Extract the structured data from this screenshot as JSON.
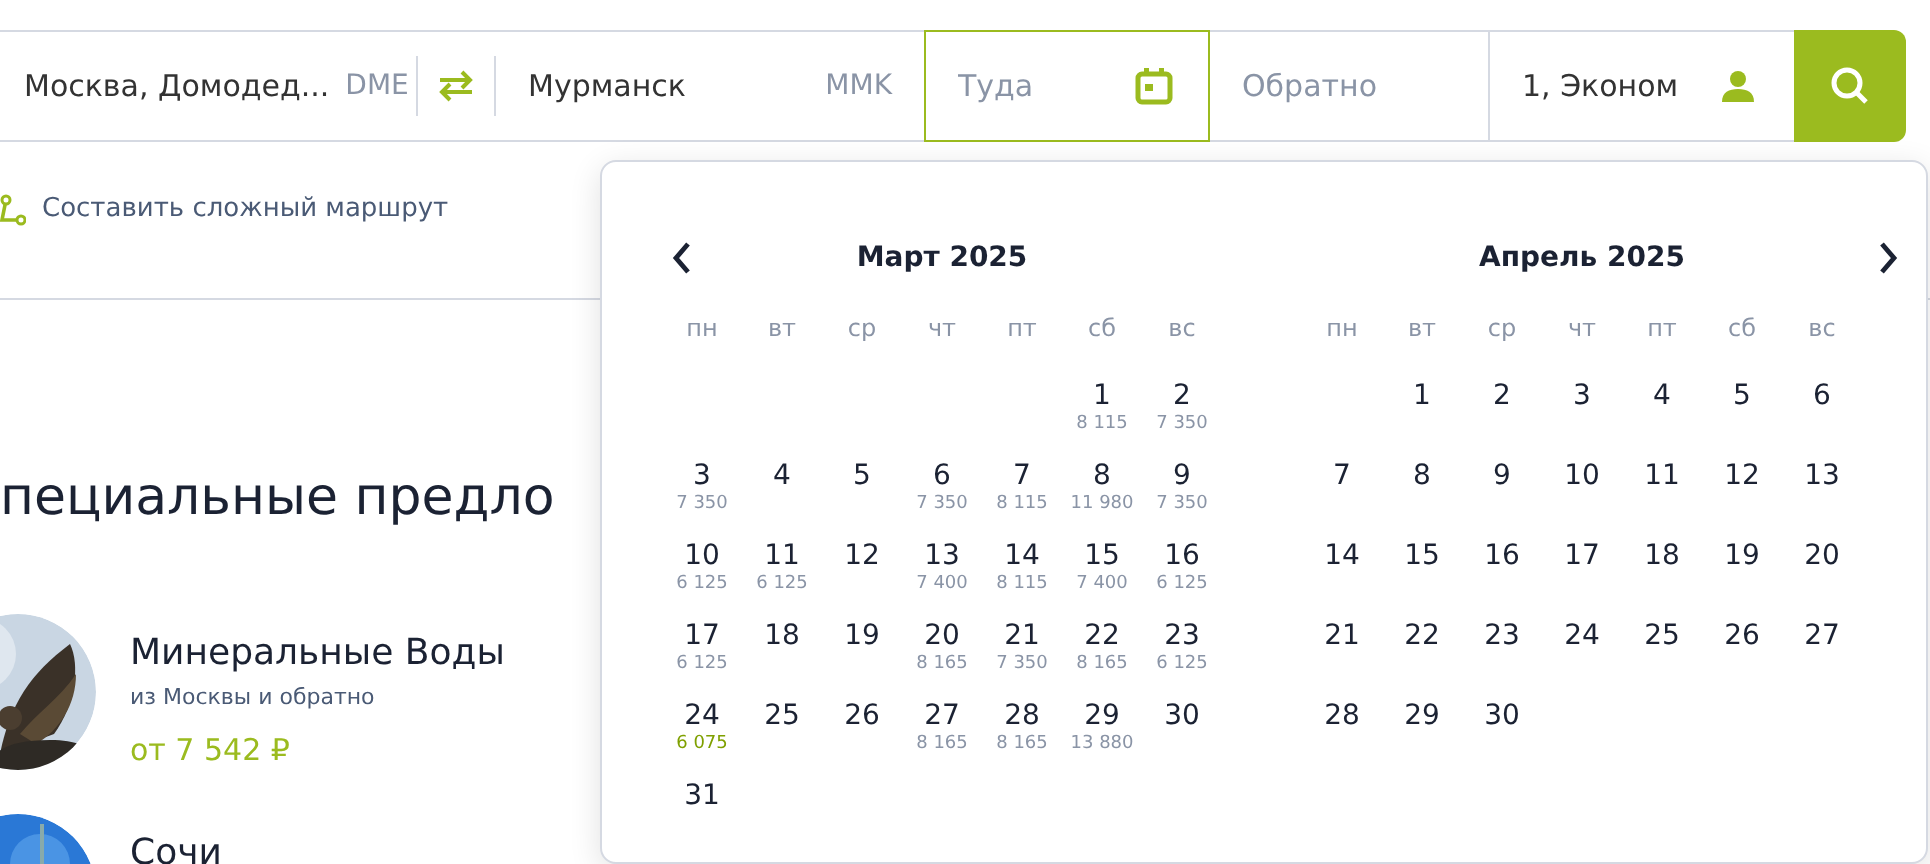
{
  "search_bar": {
    "origin": {
      "value": "Москва, Домодед...",
      "code": "DME"
    },
    "destination": {
      "value": "Мурманск",
      "code": "MMK"
    },
    "depart": {
      "placeholder": "Туда",
      "focused": true
    },
    "return": {
      "placeholder": "Обратно",
      "focused": false
    },
    "passengers": {
      "value": "1, Эконом"
    }
  },
  "complex_route_link": "Составить сложный маршрут",
  "heading": "пециальные предло",
  "offers": [
    {
      "title": "Минеральные Воды",
      "subtitle": "из Москвы и обратно",
      "price": "от 7 542 ₽",
      "kind": "statue"
    },
    {
      "title": "Сочи",
      "kind": "sky"
    }
  ],
  "calendar": {
    "months": [
      {
        "title": "Март 2025",
        "weekdays": [
          "пн",
          "вт",
          "ср",
          "чт",
          "пт",
          "сб",
          "вс"
        ],
        "weeks": [
          [
            {
              "day": "1",
              "price": "8 115",
              "cheapest": false
            },
            {
              "day": "2",
              "price": "7 350",
              "cheapest": false
            }
          ],
          [
            {
              "day": "3",
              "price": "7 350",
              "cheapest": false
            },
            {
              "day": "4"
            },
            {
              "day": "5"
            },
            {
              "day": "6",
              "price": "7 350",
              "cheapest": false
            },
            {
              "day": "7",
              "price": "8 115",
              "cheapest": false
            },
            {
              "day": "8",
              "price": "11 980",
              "cheapest": false
            },
            {
              "day": "9",
              "price": "7 350",
              "cheapest": false
            }
          ],
          [
            {
              "day": "10",
              "price": "6 125",
              "cheapest": false
            },
            {
              "day": "11",
              "price": "6 125",
              "cheapest": false
            },
            {
              "day": "12"
            },
            {
              "day": "13",
              "price": "7 400",
              "cheapest": false
            },
            {
              "day": "14",
              "price": "8 115",
              "cheapest": false
            },
            {
              "day": "15",
              "price": "7 400",
              "cheapest": false
            },
            {
              "day": "16",
              "price": "6 125",
              "cheapest": false
            }
          ],
          [
            {
              "day": "17",
              "price": "6 125",
              "cheapest": false
            },
            {
              "day": "18"
            },
            {
              "day": "19"
            },
            {
              "day": "20",
              "price": "8 165",
              "cheapest": false
            },
            {
              "day": "21",
              "price": "7 350",
              "cheapest": false
            },
            {
              "day": "22",
              "price": "8 165",
              "cheapest": false
            },
            {
              "day": "23",
              "price": "6 125",
              "cheapest": false
            }
          ],
          [
            {
              "day": "24",
              "price": "6 075",
              "cheapest": true
            },
            {
              "day": "25"
            },
            {
              "day": "26"
            },
            {
              "day": "27",
              "price": "8 165",
              "cheapest": false
            },
            {
              "day": "28",
              "price": "8 165",
              "cheapest": false
            },
            {
              "day": "29",
              "price": "13 880",
              "cheapest": false
            },
            {
              "day": "30"
            }
          ],
          [
            {
              "day": "31"
            }
          ]
        ]
      },
      {
        "title": "Апрель 2025",
        "weekdays": [
          "пн",
          "вт",
          "ср",
          "чт",
          "пт",
          "сб",
          "вс"
        ],
        "weeks": [
          [
            {
              "day": "1"
            },
            {
              "day": "2"
            },
            {
              "day": "3"
            },
            {
              "day": "4"
            },
            {
              "day": "5"
            },
            {
              "day": "6"
            }
          ],
          [
            {
              "day": "7"
            },
            {
              "day": "8"
            },
            {
              "day": "9"
            },
            {
              "day": "10"
            },
            {
              "day": "11"
            },
            {
              "day": "12"
            },
            {
              "day": "13"
            }
          ],
          [
            {
              "day": "14"
            },
            {
              "day": "15"
            },
            {
              "day": "16"
            },
            {
              "day": "17"
            },
            {
              "day": "18"
            },
            {
              "day": "19"
            },
            {
              "day": "20"
            }
          ],
          [
            {
              "day": "21"
            },
            {
              "day": "22"
            },
            {
              "day": "23"
            },
            {
              "day": "24"
            },
            {
              "day": "25"
            },
            {
              "day": "26"
            },
            {
              "day": "27"
            }
          ],
          [
            {
              "day": "28"
            },
            {
              "day": "29"
            },
            {
              "day": "30"
            }
          ]
        ]
      }
    ]
  }
}
